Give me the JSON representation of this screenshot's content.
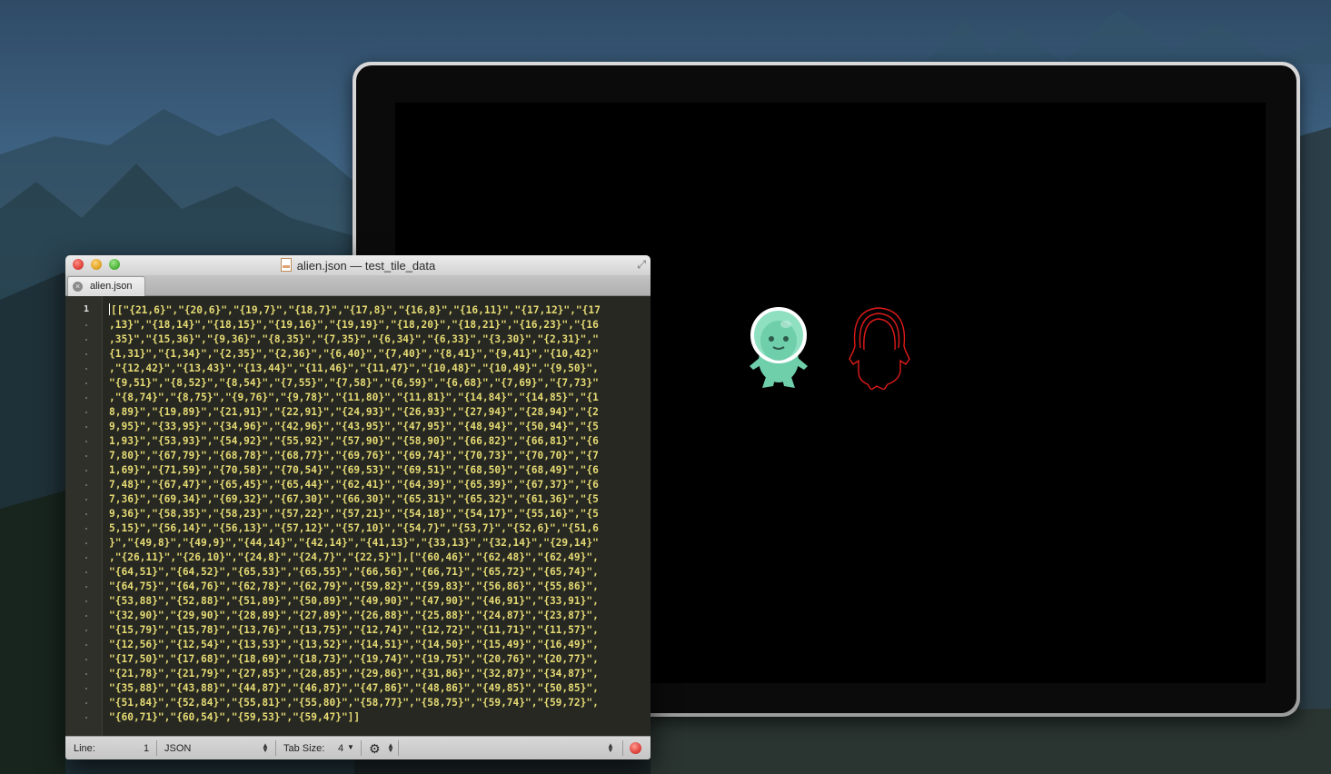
{
  "editor": {
    "window_title": "alien.json — test_tile_data",
    "tab_label": "alien.json",
    "line_number": "1",
    "code_lines": [
      "[[\"{21,6}\",\"{20,6}\",\"{19,7}\",\"{18,7}\",\"{17,8}\",\"{16,8}\",\"{16,11}\",\"{17,12}\",\"{17",
      ",13}\",\"{18,14}\",\"{18,15}\",\"{19,16}\",\"{19,19}\",\"{18,20}\",\"{18,21}\",\"{16,23}\",\"{16",
      ",35}\",\"{15,36}\",\"{9,36}\",\"{8,35}\",\"{7,35}\",\"{6,34}\",\"{6,33}\",\"{3,30}\",\"{2,31}\",\"",
      "{1,31}\",\"{1,34}\",\"{2,35}\",\"{2,36}\",\"{6,40}\",\"{7,40}\",\"{8,41}\",\"{9,41}\",\"{10,42}\"",
      ",\"{12,42}\",\"{13,43}\",\"{13,44}\",\"{11,46}\",\"{11,47}\",\"{10,48}\",\"{10,49}\",\"{9,50}\",",
      "\"{9,51}\",\"{8,52}\",\"{8,54}\",\"{7,55}\",\"{7,58}\",\"{6,59}\",\"{6,68}\",\"{7,69}\",\"{7,73}\"",
      ",\"{8,74}\",\"{8,75}\",\"{9,76}\",\"{9,78}\",\"{11,80}\",\"{11,81}\",\"{14,84}\",\"{14,85}\",\"{1",
      "8,89}\",\"{19,89}\",\"{21,91}\",\"{22,91}\",\"{24,93}\",\"{26,93}\",\"{27,94}\",\"{28,94}\",\"{2",
      "9,95}\",\"{33,95}\",\"{34,96}\",\"{42,96}\",\"{43,95}\",\"{47,95}\",\"{48,94}\",\"{50,94}\",\"{5",
      "1,93}\",\"{53,93}\",\"{54,92}\",\"{55,92}\",\"{57,90}\",\"{58,90}\",\"{66,82}\",\"{66,81}\",\"{6",
      "7,80}\",\"{67,79}\",\"{68,78}\",\"{68,77}\",\"{69,76}\",\"{69,74}\",\"{70,73}\",\"{70,70}\",\"{7",
      "1,69}\",\"{71,59}\",\"{70,58}\",\"{70,54}\",\"{69,53}\",\"{69,51}\",\"{68,50}\",\"{68,49}\",\"{6",
      "7,48}\",\"{67,47}\",\"{65,45}\",\"{65,44}\",\"{62,41}\",\"{64,39}\",\"{65,39}\",\"{67,37}\",\"{6",
      "7,36}\",\"{69,34}\",\"{69,32}\",\"{67,30}\",\"{66,30}\",\"{65,31}\",\"{65,32}\",\"{61,36}\",\"{5",
      "9,36}\",\"{58,35}\",\"{58,23}\",\"{57,22}\",\"{57,21}\",\"{54,18}\",\"{54,17}\",\"{55,16}\",\"{5",
      "5,15}\",\"{56,14}\",\"{56,13}\",\"{57,12}\",\"{57,10}\",\"{54,7}\",\"{53,7}\",\"{52,6}\",\"{51,6",
      "}\",\"{49,8}\",\"{49,9}\",\"{44,14}\",\"{42,14}\",\"{41,13}\",\"{33,13}\",\"{32,14}\",\"{29,14}\"",
      ",\"{26,11}\",\"{26,10}\",\"{24,8}\",\"{24,7}\",\"{22,5}\"],[\"{60,46}\",\"{62,48}\",\"{62,49}\",",
      "\"{64,51}\",\"{64,52}\",\"{65,53}\",\"{65,55}\",\"{66,56}\",\"{66,71}\",\"{65,72}\",\"{65,74}\",",
      "\"{64,75}\",\"{64,76}\",\"{62,78}\",\"{62,79}\",\"{59,82}\",\"{59,83}\",\"{56,86}\",\"{55,86}\",",
      "\"{53,88}\",\"{52,88}\",\"{51,89}\",\"{50,89}\",\"{49,90}\",\"{47,90}\",\"{46,91}\",\"{33,91}\",",
      "\"{32,90}\",\"{29,90}\",\"{28,89}\",\"{27,89}\",\"{26,88}\",\"{25,88}\",\"{24,87}\",\"{23,87}\",",
      "\"{15,79}\",\"{15,78}\",\"{13,76}\",\"{13,75}\",\"{12,74}\",\"{12,72}\",\"{11,71}\",\"{11,57}\",",
      "\"{12,56}\",\"{12,54}\",\"{13,53}\",\"{13,52}\",\"{14,51}\",\"{14,50}\",\"{15,49}\",\"{16,49}\",",
      "\"{17,50}\",\"{17,68}\",\"{18,69}\",\"{18,73}\",\"{19,74}\",\"{19,75}\",\"{20,76}\",\"{20,77}\",",
      "\"{21,78}\",\"{21,79}\",\"{27,85}\",\"{28,85}\",\"{29,86}\",\"{31,86}\",\"{32,87}\",\"{34,87}\",",
      "\"{35,88}\",\"{43,88}\",\"{44,87}\",\"{46,87}\",\"{47,86}\",\"{48,86}\",\"{49,85}\",\"{50,85}\",",
      "\"{51,84}\",\"{52,84}\",\"{55,81}\",\"{55,80}\",\"{58,77}\",\"{58,75}\",\"{59,74}\",\"{59,72}\",",
      "\"{60,71}\",\"{60,54}\",\"{59,53}\",\"{59,47}\"]]"
    ],
    "status": {
      "line_label": "Line:",
      "line_value": "1",
      "syntax": "JSON",
      "tab_size_label": "Tab Size:",
      "tab_size_value": "4"
    }
  },
  "colors": {
    "alien_body": "#6fcfaa",
    "alien_outline": "#e01a1a",
    "editor_bg": "#272822",
    "code_string": "#e6db74"
  },
  "icons": [
    "close-icon",
    "minimize-icon",
    "zoom-icon",
    "document-icon",
    "fullscreen-icon",
    "gear-icon",
    "record-icon"
  ]
}
